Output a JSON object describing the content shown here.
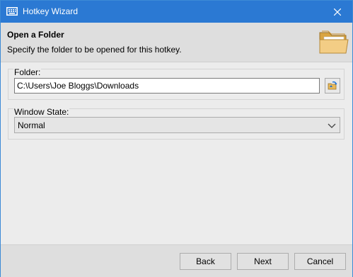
{
  "window": {
    "title": "Hotkey Wizard"
  },
  "header": {
    "title": "Open a Folder",
    "subtitle": "Specify the folder to be opened for this hotkey."
  },
  "folder_group": {
    "label": "Folder:",
    "value": "C:\\Users\\Joe Bloggs\\Downloads"
  },
  "window_state_group": {
    "label": "Window State:",
    "selected": "Normal"
  },
  "buttons": {
    "back": "Back",
    "next": "Next",
    "cancel": "Cancel"
  },
  "icons": {
    "app": "keyboard-icon",
    "close": "close-icon",
    "header": "folder-icon",
    "browse": "folder-browse-icon",
    "dropdown": "chevron-down-icon"
  },
  "colors": {
    "titlebar": "#2b79d3",
    "header_band": "#dedede",
    "body": "#ececec"
  }
}
